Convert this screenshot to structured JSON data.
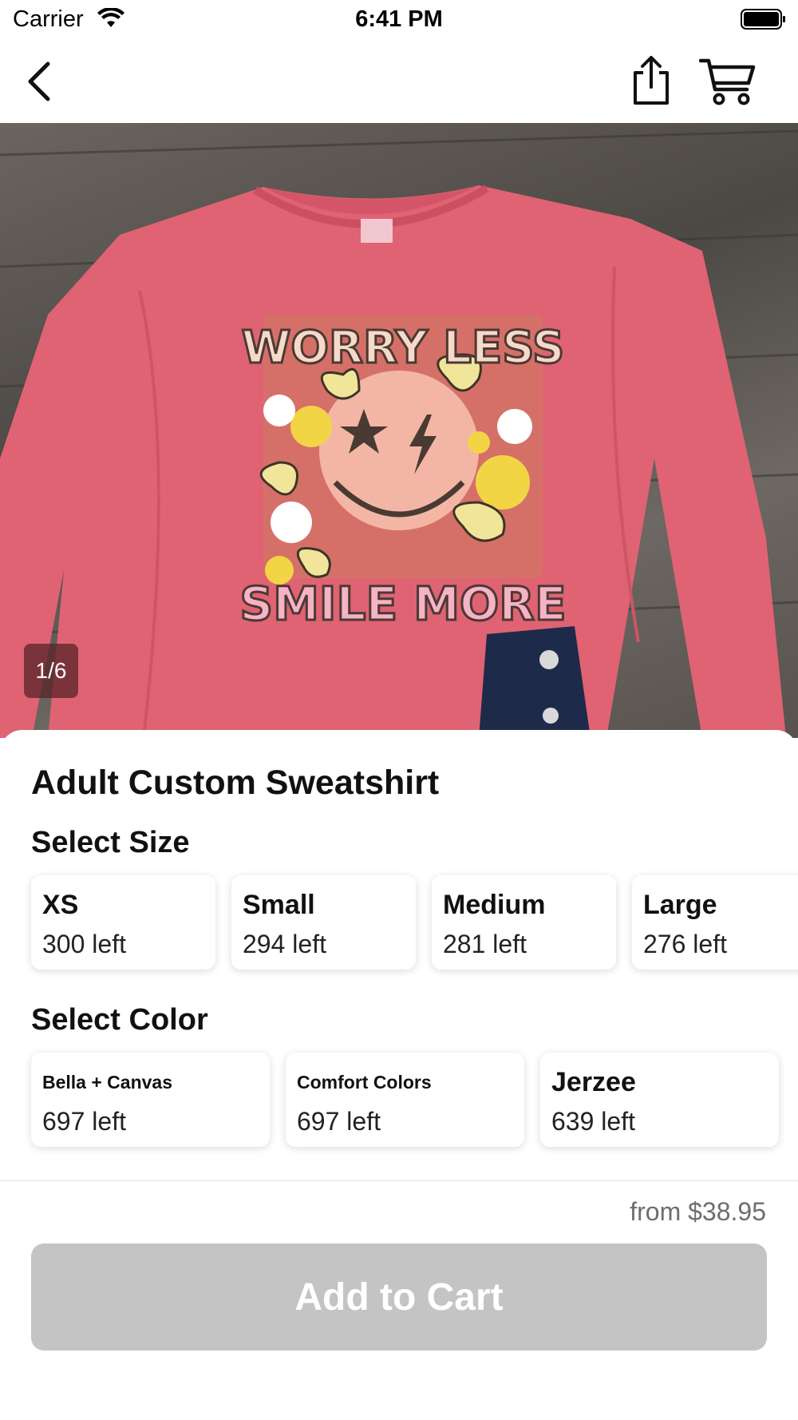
{
  "status_bar": {
    "carrier": "Carrier",
    "time": "6:41 PM"
  },
  "nav": {
    "back_icon": "chevron-left-icon",
    "share_icon": "share-icon",
    "cart_icon": "cart-icon"
  },
  "gallery": {
    "counter": "1/6",
    "print_text_top": "WORRY LESS",
    "print_text_bottom": "SMILE MORE",
    "shirt_color": "#e06373"
  },
  "product": {
    "title": "Adult Custom Sweatshirt"
  },
  "size_section": {
    "title": "Select Size",
    "options": [
      {
        "name": "XS",
        "stock": "300 left"
      },
      {
        "name": "Small",
        "stock": "294 left"
      },
      {
        "name": "Medium",
        "stock": "281 left"
      },
      {
        "name": "Large",
        "stock": "276 left"
      }
    ]
  },
  "color_section": {
    "title": "Select Color",
    "options": [
      {
        "name": "Bella + Canvas",
        "stock": "697 left"
      },
      {
        "name": "Comfort Colors",
        "stock": "697 left"
      },
      {
        "name": "Jerzee",
        "stock": "639 left"
      }
    ]
  },
  "footer": {
    "price": "from $38.95",
    "add_to_cart_label": "Add to Cart",
    "button_color": "#c4c4c4"
  }
}
